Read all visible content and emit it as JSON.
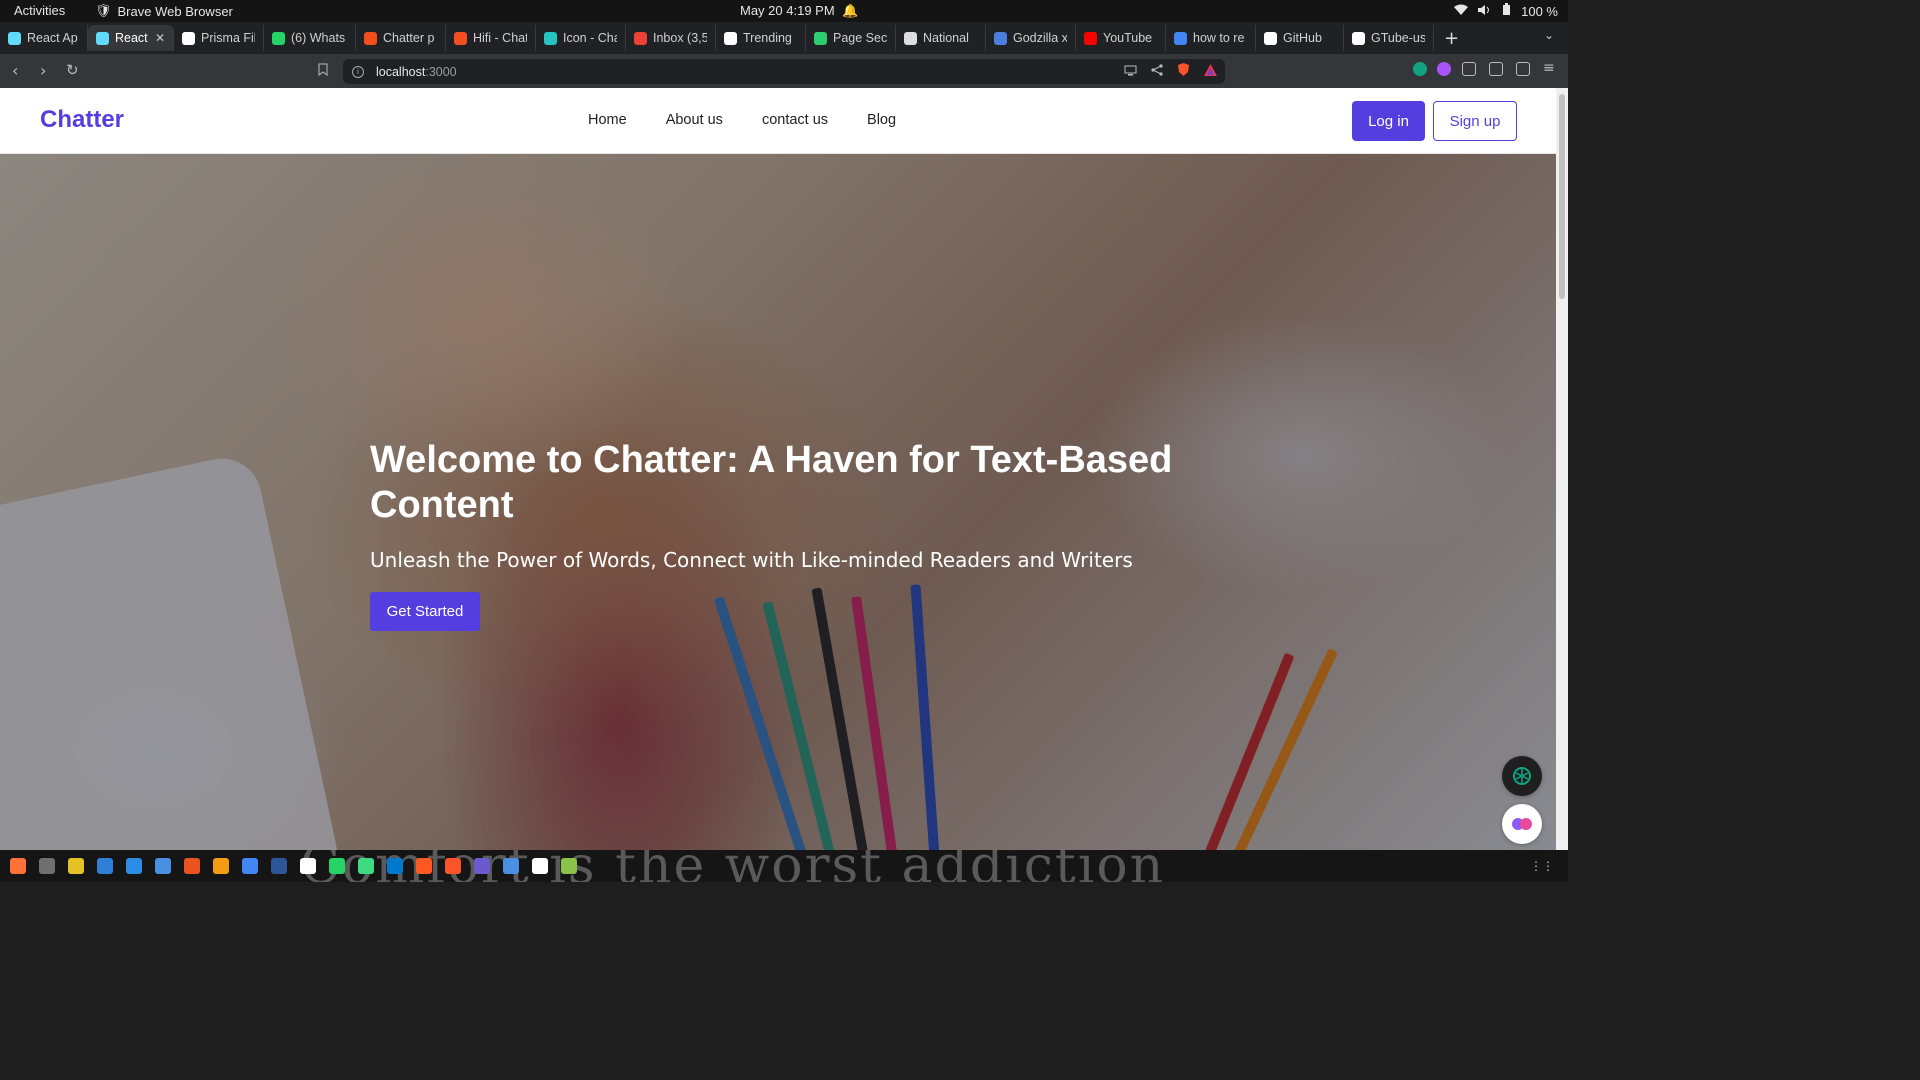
{
  "system": {
    "activities": "Activities",
    "app_name": "Brave Web Browser",
    "clock": "May 20  4:19 PM",
    "battery": "100 %"
  },
  "tabs": [
    {
      "label": "React Ap",
      "color": "#61dafb"
    },
    {
      "label": "React",
      "color": "#61dafb",
      "active": true
    },
    {
      "label": "Prisma Fil",
      "color": "#ffffff"
    },
    {
      "label": "(6) Whats",
      "color": "#25d366"
    },
    {
      "label": "Chatter p",
      "color": "#f24e1e"
    },
    {
      "label": "Hifi - Chat",
      "color": "#f24e1e"
    },
    {
      "label": "Icon - Cha",
      "color": "#27c3c3"
    },
    {
      "label": "Inbox (3,5",
      "color": "#ea4335"
    },
    {
      "label": "Trending",
      "color": "#ffffff"
    },
    {
      "label": "Page Sect",
      "color": "#2ecc71"
    },
    {
      "label": "National",
      "color": "#dddddd"
    },
    {
      "label": "Godzilla x",
      "color": "#4a7fe0"
    },
    {
      "label": "YouTube",
      "color": "#ff0000"
    },
    {
      "label": "how to re",
      "color": "#4285f4"
    },
    {
      "label": "GitHub",
      "color": "#ffffff"
    },
    {
      "label": "GTube-us",
      "color": "#ffffff"
    }
  ],
  "address": {
    "host": "localhost",
    "port": ":3000"
  },
  "site": {
    "logo": "Chatter",
    "nav": [
      "Home",
      "About us",
      "contact us",
      "Blog"
    ],
    "login": "Log in",
    "signup": "Sign up",
    "brand_color": "#543ee0"
  },
  "hero": {
    "title": "Welcome to Chatter: A Haven for Text-Based Content",
    "subtitle": "Unleash the Power of Words, Connect with Like-minded Readers and Writers",
    "cta": "Get Started"
  },
  "wallpaper_text": "Comfort is the worst addiction",
  "dock": [
    "#ff7139",
    "#6f6f6f",
    "#e6c229",
    "#2f7fd8",
    "#2c8ce8",
    "#4a90e2",
    "#e95420",
    "#f39c12",
    "#4285f4",
    "#2b5797",
    "#ffffff",
    "#25d366",
    "#3ddc84",
    "#007acc",
    "#ff5722",
    "#fb542b",
    "#6a5acd",
    "#4a90e2",
    "#ffffff",
    "#8bc34a"
  ]
}
